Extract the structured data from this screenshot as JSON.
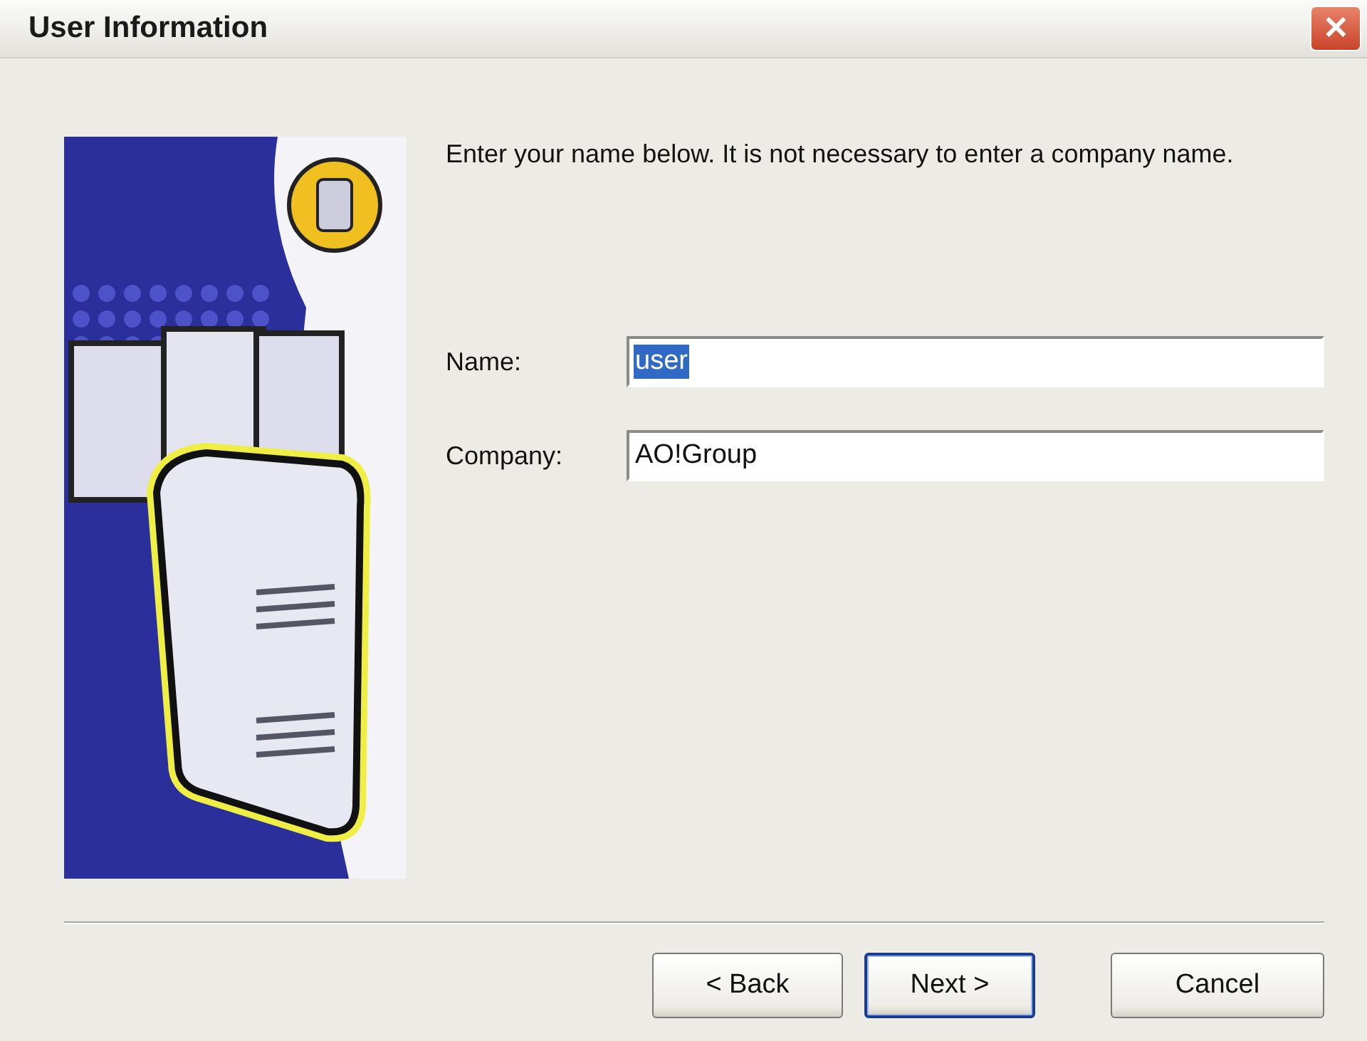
{
  "window": {
    "title": "User Information",
    "close": "✕"
  },
  "instructions": "Enter your name below.  It is not necessary to enter a company name.",
  "fields": [
    {
      "label": "Name:",
      "value": "user",
      "text_selected": true
    },
    {
      "label": "Company:",
      "value": "AO!Group",
      "text_selected": false
    }
  ],
  "buttons": [
    {
      "label": "< Back",
      "default": false
    },
    {
      "label": "Next >",
      "default": true
    },
    {
      "label": "Cancel",
      "default": false
    }
  ]
}
